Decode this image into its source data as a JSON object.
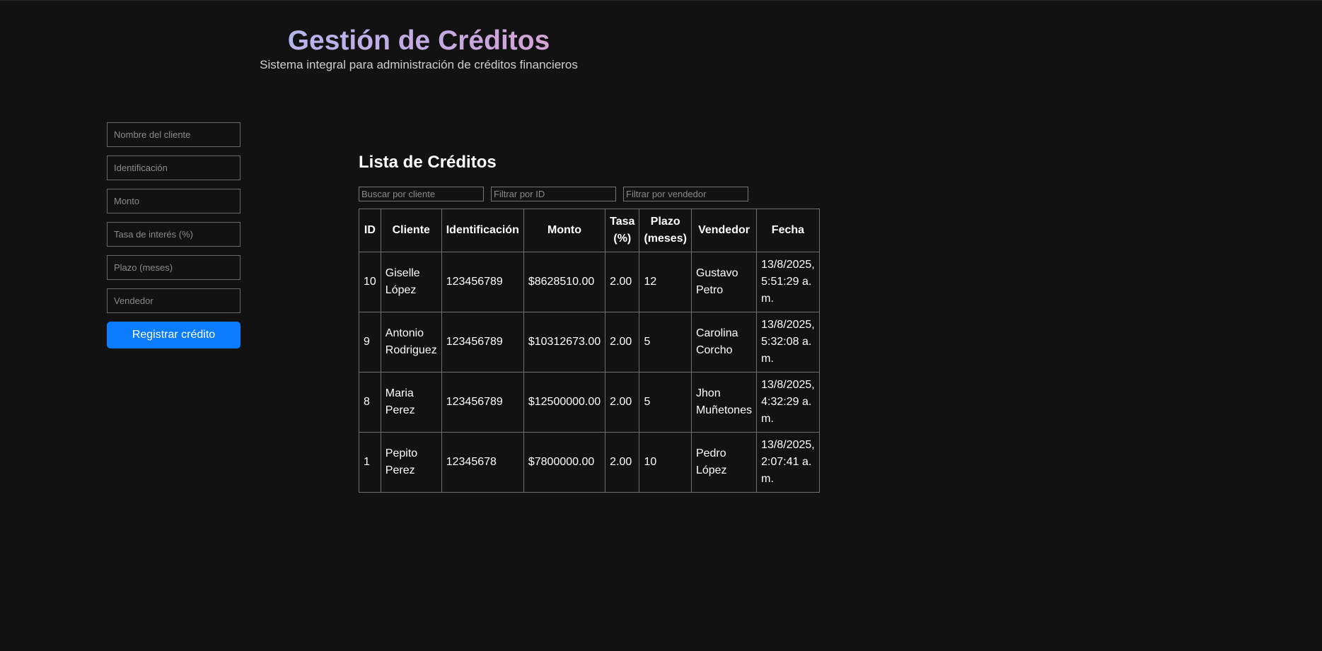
{
  "header": {
    "title": "Gestión de Créditos",
    "subtitle": "Sistema integral para administración de créditos financieros"
  },
  "form": {
    "client_name_placeholder": "Nombre del cliente",
    "identification_placeholder": "Identificación",
    "amount_placeholder": "Monto",
    "rate_placeholder": "Tasa de interés (%)",
    "term_placeholder": "Plazo (meses)",
    "seller_placeholder": "Vendedor",
    "submit_label": "Registrar crédito"
  },
  "list": {
    "title": "Lista de Créditos",
    "search_client_placeholder": "Buscar por cliente",
    "filter_id_placeholder": "Filtrar por ID",
    "filter_seller_placeholder": "Filtrar por vendedor",
    "columns": {
      "id": "ID",
      "client": "Cliente",
      "identification": "Identificación",
      "amount": "Monto",
      "rate": "Tasa (%)",
      "term": "Plazo (meses)",
      "seller": "Vendedor",
      "date": "Fecha"
    },
    "rows": [
      {
        "id": "10",
        "client": "Giselle López",
        "identification": "123456789",
        "amount": "$8628510.00",
        "rate": "2.00",
        "term": "12",
        "seller": "Gustavo Petro",
        "date": "13/8/2025, 5:51:29 a. m."
      },
      {
        "id": "9",
        "client": "Antonio Rodriguez",
        "identification": "123456789",
        "amount": "$10312673.00",
        "rate": "2.00",
        "term": "5",
        "seller": "Carolina Corcho",
        "date": "13/8/2025, 5:32:08 a. m."
      },
      {
        "id": "8",
        "client": "Maria Perez",
        "identification": "123456789",
        "amount": "$12500000.00",
        "rate": "2.00",
        "term": "5",
        "seller": "Jhon Muñetones",
        "date": "13/8/2025, 4:32:29 a. m."
      },
      {
        "id": "1",
        "client": "Pepito Perez",
        "identification": "12345678",
        "amount": "$7800000.00",
        "rate": "2.00",
        "term": "10",
        "seller": "Pedro López",
        "date": "13/8/2025, 2:07:41 a. m."
      }
    ]
  }
}
